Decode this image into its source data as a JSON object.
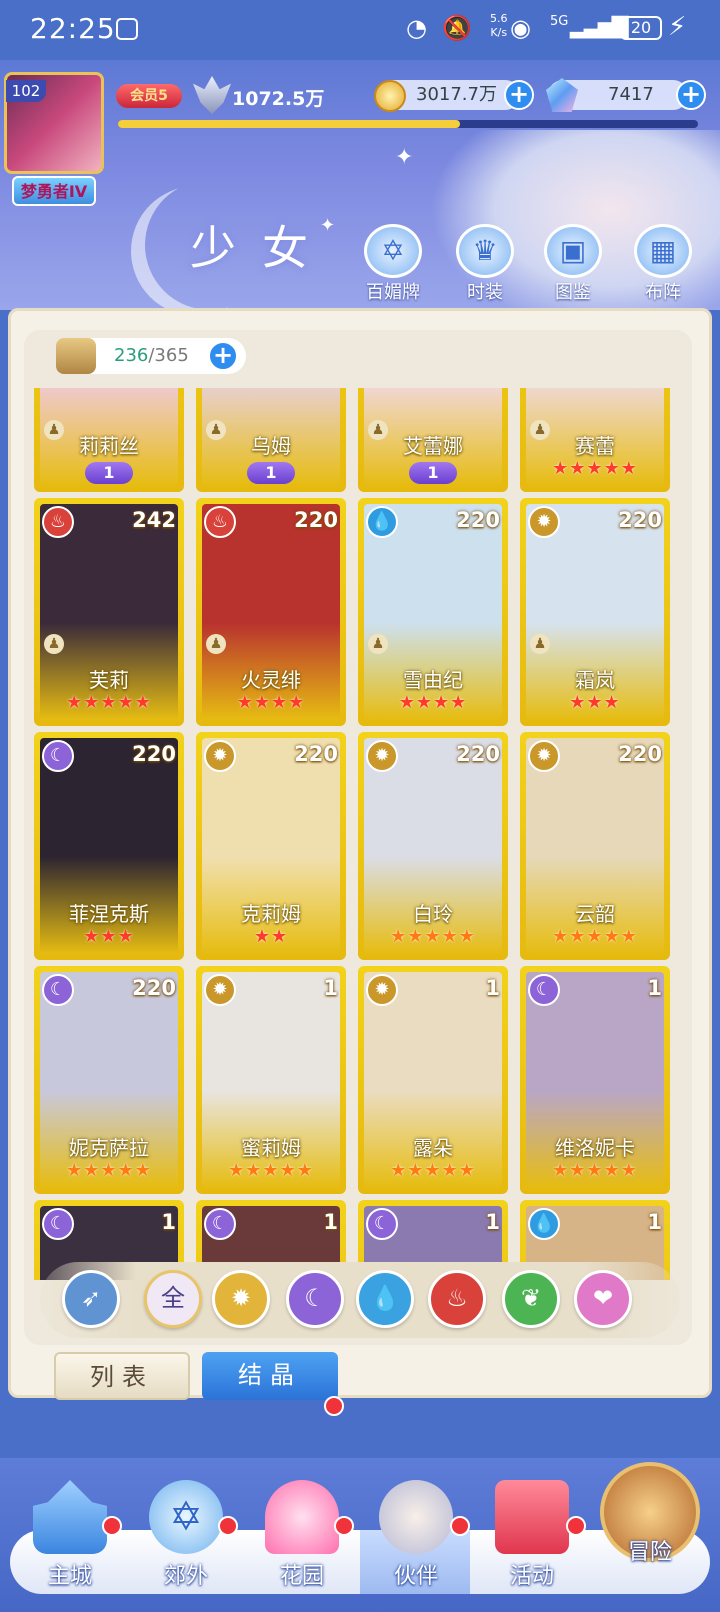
{
  "status_bar": {
    "time": "22:25",
    "net_speed": "5.6",
    "net_unit": "K/s",
    "signal": "5G",
    "battery": "20"
  },
  "player": {
    "level": "102",
    "rank_title": "梦勇者IV",
    "vip": "会员5",
    "power": "1072.5万",
    "exp_progress": 0.59
  },
  "currencies": {
    "gold": "3017.7万",
    "gems": "7417"
  },
  "header": {
    "title": "少女",
    "buttons": [
      {
        "label": "百媚牌",
        "icon": "card-icon"
      },
      {
        "label": "时装",
        "icon": "outfit-icon"
      },
      {
        "label": "图鉴",
        "icon": "book-icon"
      },
      {
        "label": "布阵",
        "icon": "grid-icon"
      }
    ]
  },
  "collection": {
    "owned": "236",
    "total": "/365"
  },
  "characters": [
    {
      "name": "莉莉丝",
      "badge": "1",
      "color": "#efc9c9"
    },
    {
      "name": "乌姆",
      "badge": "1",
      "color": "#e8cfc8"
    },
    {
      "name": "艾蕾娜",
      "badge": "1",
      "color": "#f0d6cf"
    },
    {
      "name": "赛蕾",
      "stars": "★★★★★",
      "color": "#eed7cc"
    },
    {
      "name": "芙莉",
      "level": "242",
      "stars": "★★★★★",
      "element": "fire-icon",
      "color": "#3a2a3a"
    },
    {
      "name": "火灵绯",
      "level": "220",
      "stars": "★★★★",
      "element": "fire-icon",
      "color": "#b8322e"
    },
    {
      "name": "雪由纪",
      "level": "220",
      "stars": "★★★★",
      "element": "water-icon",
      "color": "#cde0ee"
    },
    {
      "name": "霜岚",
      "level": "220",
      "stars": "★★★",
      "element": "light-icon",
      "color": "#d6e2ee"
    },
    {
      "name": "菲涅克斯",
      "level": "220",
      "stars": "★★★",
      "element": "dark-icon",
      "color": "#2c2430"
    },
    {
      "name": "克莉姆",
      "level": "220",
      "stars": "★★",
      "element": "light-icon",
      "color": "#f0dfae"
    },
    {
      "name": "白玲",
      "level": "220",
      "stars": "★★★★★",
      "element": "light-icon",
      "color": "#dadde6"
    },
    {
      "name": "云韶",
      "level": "220",
      "stars": "★★★★★",
      "element": "light-icon",
      "color": "#e6d8b8"
    },
    {
      "name": "妮克萨拉",
      "level": "220",
      "stars": "★★★★★",
      "element": "dark-icon",
      "color": "#c8c8dc"
    },
    {
      "name": "蜜莉姆",
      "level": "1",
      "stars": "★★★★★",
      "element": "light-icon",
      "color": "#e8e4e0"
    },
    {
      "name": "露朵",
      "level": "1",
      "stars": "★★★★★",
      "element": "light-icon",
      "color": "#eadcc0"
    },
    {
      "name": "维洛妮卡",
      "level": "1",
      "stars": "★★★★★",
      "element": "dark-icon",
      "color": "#b9a6c6"
    },
    {
      "name": "",
      "level": "1",
      "element": "dark-icon",
      "color": "#3a3040"
    },
    {
      "name": "",
      "level": "1",
      "element": "dark-icon",
      "color": "#6a3a3a"
    },
    {
      "name": "",
      "level": "1",
      "element": "dark-icon",
      "color": "#8a7ab0"
    },
    {
      "name": "",
      "level": "1",
      "element": "water-icon",
      "color": "#d6b488"
    }
  ],
  "filters": [
    {
      "icon": "wind-icon",
      "label": "",
      "color": "#5f93d2"
    },
    {
      "icon": "all-icon",
      "label": "全",
      "color": "#f0e8f4"
    },
    {
      "icon": "light-icon",
      "label": "",
      "color": "#e2b53a"
    },
    {
      "icon": "dark-icon",
      "label": "",
      "color": "#8d63d8"
    },
    {
      "icon": "water-icon",
      "label": "",
      "color": "#3aa2e0"
    },
    {
      "icon": "fire-icon",
      "label": "",
      "color": "#d8423a"
    },
    {
      "icon": "nature-icon",
      "label": "",
      "color": "#4cb452"
    },
    {
      "icon": "charm-icon",
      "label": "",
      "color": "#e07ac8"
    }
  ],
  "tabs": {
    "list": "列表",
    "crystal": "结晶"
  },
  "nav": [
    {
      "label": "主城"
    },
    {
      "label": "郊外"
    },
    {
      "label": "花园"
    },
    {
      "label": "伙伴"
    },
    {
      "label": "活动"
    },
    {
      "label": "冒险"
    }
  ]
}
